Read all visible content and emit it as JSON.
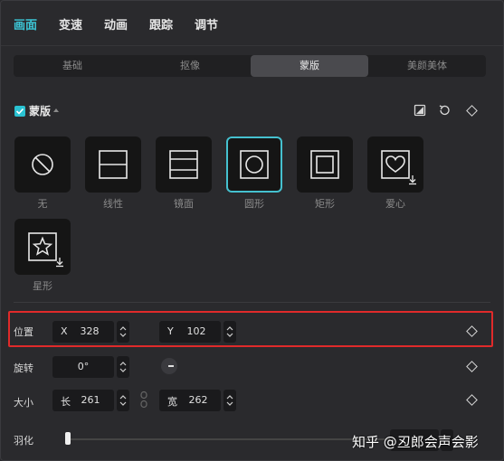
{
  "top_tabs": [
    "画面",
    "变速",
    "动画",
    "跟踪",
    "调节"
  ],
  "sub_tabs": [
    "基础",
    "抠像",
    "蒙版",
    "美颜美体"
  ],
  "mask": {
    "title": "蒙版",
    "checked": true,
    "shapes": [
      "无",
      "线性",
      "镜面",
      "圆形",
      "矩形",
      "爱心",
      "星形"
    ],
    "selected": "圆形"
  },
  "position": {
    "label": "位置",
    "x_prefix": "X",
    "x_value": "328",
    "y_prefix": "Y",
    "y_value": "102"
  },
  "rotation": {
    "label": "旋转",
    "value": "0°"
  },
  "size": {
    "label": "大小",
    "w_prefix": "长",
    "w_value": "261",
    "h_prefix": "宽",
    "h_value": "262"
  },
  "feather": {
    "label": "羽化"
  },
  "watermark": "知乎 @丒郎会声会影",
  "colors": {
    "accent": "#3cc6d6",
    "highlight": "#e02a2a"
  },
  "icons": [
    "checkbox-icon",
    "caret-up-icon",
    "invert-icon",
    "reset-icon",
    "keyframe-diamond-icon",
    "none-icon",
    "linear-icon",
    "mirror-icon",
    "circle-icon",
    "rectangle-icon",
    "heart-icon",
    "star-icon",
    "download-icon",
    "stepper-icon",
    "link-icon"
  ]
}
